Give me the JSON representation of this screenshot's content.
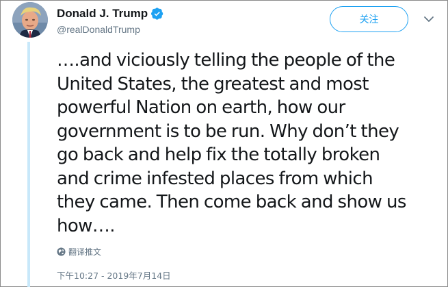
{
  "author": {
    "display_name": "Donald J. Trump",
    "handle": "@realDonaldTrump",
    "verified": true,
    "avatar_icon": "avatar-photo"
  },
  "actions": {
    "follow_label": "关注",
    "more_icon": "chevron-down-icon"
  },
  "tweet": {
    "text": "….and viciously telling the people of the\nUnited States, the greatest and most\npowerful Nation on earth, how our\ngovernment is to be run. Why don’t they\ngo back and help fix the totally broken\nand crime infested places from which\nthey came. Then come back and show us\nhow….",
    "translate_label": "翻译推文",
    "timestamp": "下午10:27 - 2019年7月14日"
  },
  "colors": {
    "accent": "#1da1f2",
    "thread_line": "#c8e8fa",
    "muted_text": "#657786"
  }
}
